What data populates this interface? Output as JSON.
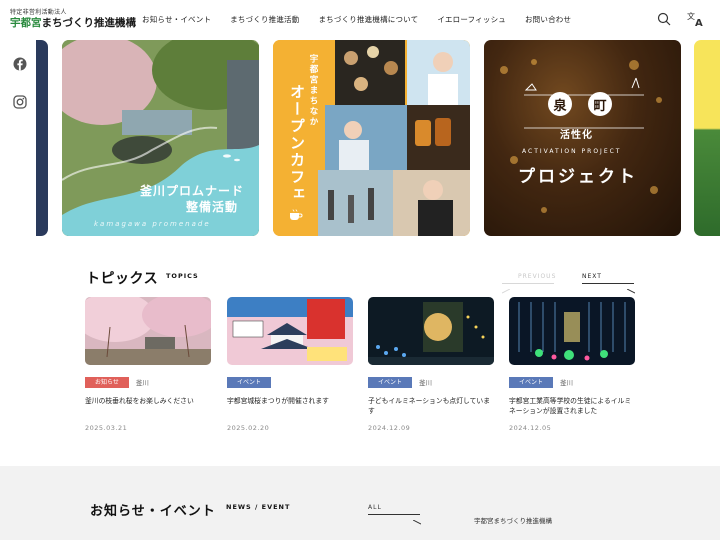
{
  "header": {
    "logo_sub": "特定非営利活動法人",
    "logo_main_a": "宇都宮",
    "logo_main_b": "まちづくり推進機構",
    "nav": [
      "お知らせ・イベント",
      "まちづくり推進活動",
      "まちづくり推進機構について",
      "イエローフィッシュ",
      "お問い合わせ"
    ],
    "search_icon": "search-icon",
    "language_icon": "translate-icon"
  },
  "social": [
    "facebook-icon",
    "instagram-icon"
  ],
  "slides": [
    {
      "title_line1": "釜川プロムナード",
      "title_line2": "整備活動",
      "subtitle": "kamagawa promenade",
      "accent_color": "#7fd0d8"
    },
    {
      "title_small": "宇都宮まちなか",
      "title_large": "オープンカフェ",
      "accent_color": "#f4b133"
    },
    {
      "circle_left": "泉",
      "circle_right": "町",
      "title_mid": "活性化",
      "subtitle": "ACTIVATION PROJECT",
      "title_large": "プロジェクト"
    }
  ],
  "topics": {
    "title": "トピックス",
    "title_en": "TOPICS",
    "prev": "PREVIOUS",
    "next": "NEXT",
    "cards": [
      {
        "tag": "お知らせ",
        "tag_color": "red",
        "place": "釜川",
        "title": "釜川の枝垂れ桜をお楽しみください",
        "date": "2025.03.21"
      },
      {
        "tag": "イベント",
        "tag_color": "blue",
        "place": "",
        "title": "宇都宮城桜まつりが開催されます",
        "date": "2025.02.20"
      },
      {
        "tag": "イベント",
        "tag_color": "blue",
        "place": "釜川",
        "title": "子どもイルミネーションも点灯しています",
        "date": "2024.12.09"
      },
      {
        "tag": "イベント",
        "tag_color": "blue",
        "place": "釜川",
        "title": "宇都宮工業高等学校の生徒によるイルミネーションが設置されました",
        "date": "2024.12.05"
      }
    ]
  },
  "news": {
    "title": "お知らせ・イベント",
    "title_en": "NEWS / EVENT",
    "all": "ALL",
    "org": "宇都宮まちづくり推進機構"
  }
}
